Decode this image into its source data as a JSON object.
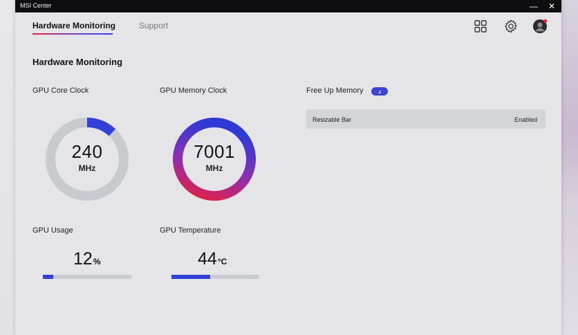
{
  "window": {
    "title": "MSI Center",
    "minimize_glyph": "—",
    "close_glyph": "✕"
  },
  "tabs": [
    {
      "label": "Hardware Monitoring",
      "active": true
    },
    {
      "label": "Support",
      "active": false
    }
  ],
  "top_icons": [
    "grid-icon",
    "gear-icon",
    "avatar-icon"
  ],
  "section": {
    "title": "Hardware Monitoring"
  },
  "gauges": {
    "core_clock": {
      "label": "GPU Core Clock",
      "value": "240",
      "unit": "MHz",
      "fraction": 0.12
    },
    "memory_clock": {
      "label": "GPU Memory Clock",
      "value": "7001",
      "unit": "MHz",
      "fraction": 1.0
    }
  },
  "metrics": {
    "usage": {
      "label": "GPU Usage",
      "value": "12",
      "unit": "%",
      "fraction": 0.12
    },
    "temperature": {
      "label": "GPU Temperature",
      "value": "44",
      "unit": "°C",
      "fraction": 0.44
    }
  },
  "free_up_memory": {
    "label": "Free Up Memory"
  },
  "resizable_bar": {
    "label": "Resizable Bar",
    "value": "Enabled"
  },
  "colors": {
    "accent_blue": "#3340d6",
    "accent_red": "#e8203f",
    "track_gray": "#c7cace",
    "titlebar": "#0e0e10"
  }
}
